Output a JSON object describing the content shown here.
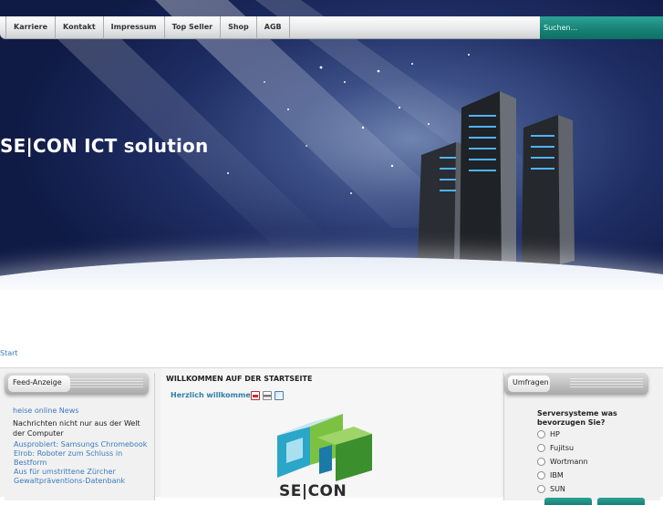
{
  "nav": {
    "items": [
      "Karriere",
      "Kontakt",
      "Impressum",
      "Top Seller",
      "Shop",
      "AGB"
    ],
    "search_placeholder": "Suchen..."
  },
  "hero": {
    "brand": "SE|CON ICT solution"
  },
  "breadcrumb": "Start",
  "left": {
    "module_title": "Feed-Anzeige",
    "feed_title": "heise online News",
    "feed_desc": "Nachrichten nicht nur aus der Welt der Computer",
    "items": [
      "Ausprobiert: Samsungs Chromebook",
      "Elrob: Roboter zum Schluss in Bestform",
      "Aus für umstrittene Zürcher Gewaltpräventions-Datenbank"
    ]
  },
  "main": {
    "title": "WILLKOMMEN AUF DER STARTSEITE",
    "welcome": "Herzlich willkommen!",
    "logo_word": "SE|CON",
    "icons": [
      "pdf-icon",
      "print-icon",
      "email-icon"
    ]
  },
  "right": {
    "module_title": "Umfragen",
    "question": "Serversysteme was bevorzugen Sie?",
    "options": [
      "HP",
      "Fujitsu",
      "Wortmann",
      "IBM",
      "SUN"
    ]
  },
  "colors": {
    "accent_teal": "#168073",
    "link_blue": "#3a7bbf",
    "hero_navy": "#1e2d63"
  }
}
